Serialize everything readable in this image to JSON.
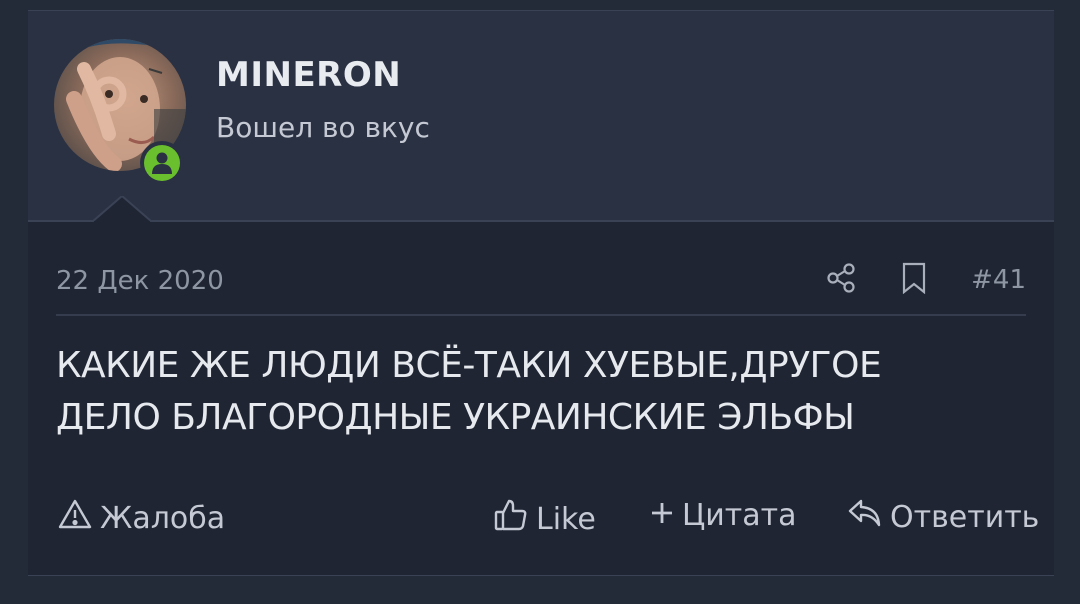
{
  "post": {
    "username": "MINERON",
    "user_title": "Вошел во вкус",
    "date": "22 Дек 2020",
    "post_number": "#41",
    "content_lines": [
      "КАКИЕ ЖЕ ЛЮДИ ВСЁ-ТАКИ ХУЕВЫЕ,ДРУГОЕ",
      "ДЕЛО БЛАГОРОДНЫЕ УКРАИНСКИЕ ЭЛЬФЫ"
    ],
    "actions": {
      "report": "Жалоба",
      "like": "Like",
      "quote": "Цитата",
      "reply": "Ответить"
    }
  },
  "icons": {
    "online": "user-online-icon",
    "share": "share-icon",
    "bookmark": "bookmark-icon",
    "report": "warning-icon",
    "like": "thumbs-up-icon",
    "quote": "plus-icon",
    "reply": "reply-icon"
  },
  "colors": {
    "background": "#232a38",
    "user_block": "#2a3143",
    "message": "#1f2533",
    "online": "#6abf2e",
    "text": "#e6e9ee",
    "muted": "#8f96a3"
  }
}
